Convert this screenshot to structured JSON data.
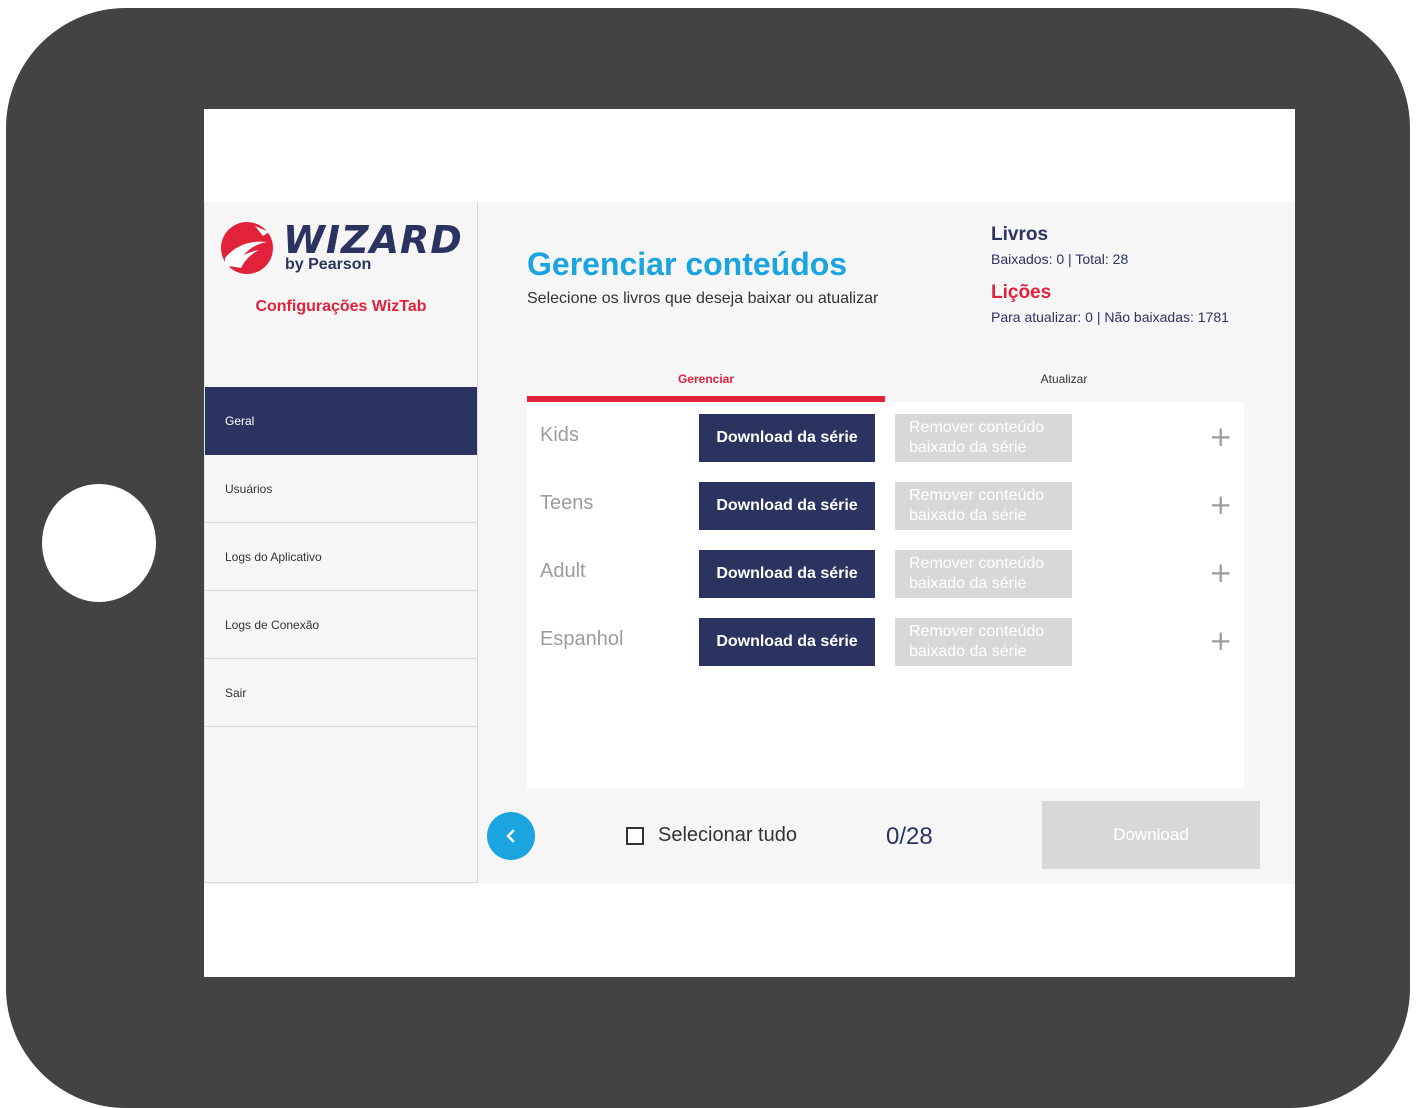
{
  "sidebar": {
    "logo": {
      "word": "WIZARD",
      "sub": "by Pearson"
    },
    "title": "Configurações WizTab",
    "items": [
      {
        "label": "Geral",
        "active": true
      },
      {
        "label": "Usuários",
        "active": false
      },
      {
        "label": "Logs do Aplicativo",
        "active": false
      },
      {
        "label": "Logs de Conexão",
        "active": false
      },
      {
        "label": "Sair",
        "active": false
      }
    ]
  },
  "header": {
    "title": "Gerenciar conteúdos",
    "subtitle": "Selecione os livros que deseja baixar ou atualizar"
  },
  "stats": {
    "books_title": "Livros",
    "books_value": "Baixados: 0 | Total: 28",
    "lessons_title": "Lições",
    "lessons_value": "Para atualizar: 0 | Não baixadas: 1781"
  },
  "tabs": [
    {
      "label": "Gerenciar",
      "active": true
    },
    {
      "label": "Atualizar",
      "active": false
    }
  ],
  "series": [
    {
      "name": "Kids",
      "download_label": "Download da série",
      "remove_label": "Remover conteúdo baixado da série"
    },
    {
      "name": "Teens",
      "download_label": "Download da série",
      "remove_label": "Remover conteúdo baixado da série"
    },
    {
      "name": "Adult",
      "download_label": "Download da série",
      "remove_label": "Remover conteúdo baixado da série"
    },
    {
      "name": "Espanhol",
      "download_label": "Download da série",
      "remove_label": "Remover conteúdo baixado da série"
    }
  ],
  "footer": {
    "select_all_label": "Selecionar tudo",
    "counter": "0/28",
    "download_label": "Download"
  },
  "colors": {
    "brand_navy": "#2b3460",
    "brand_red": "#e2223b",
    "accent_blue": "#1aa5e1",
    "disabled_gray": "#d8d8d8",
    "device_frame": "#434343"
  },
  "icons": {
    "plus": "plus-icon",
    "back": "chevron-left-icon",
    "logo": "eagle-logo-icon",
    "checkbox": "checkbox-icon"
  }
}
